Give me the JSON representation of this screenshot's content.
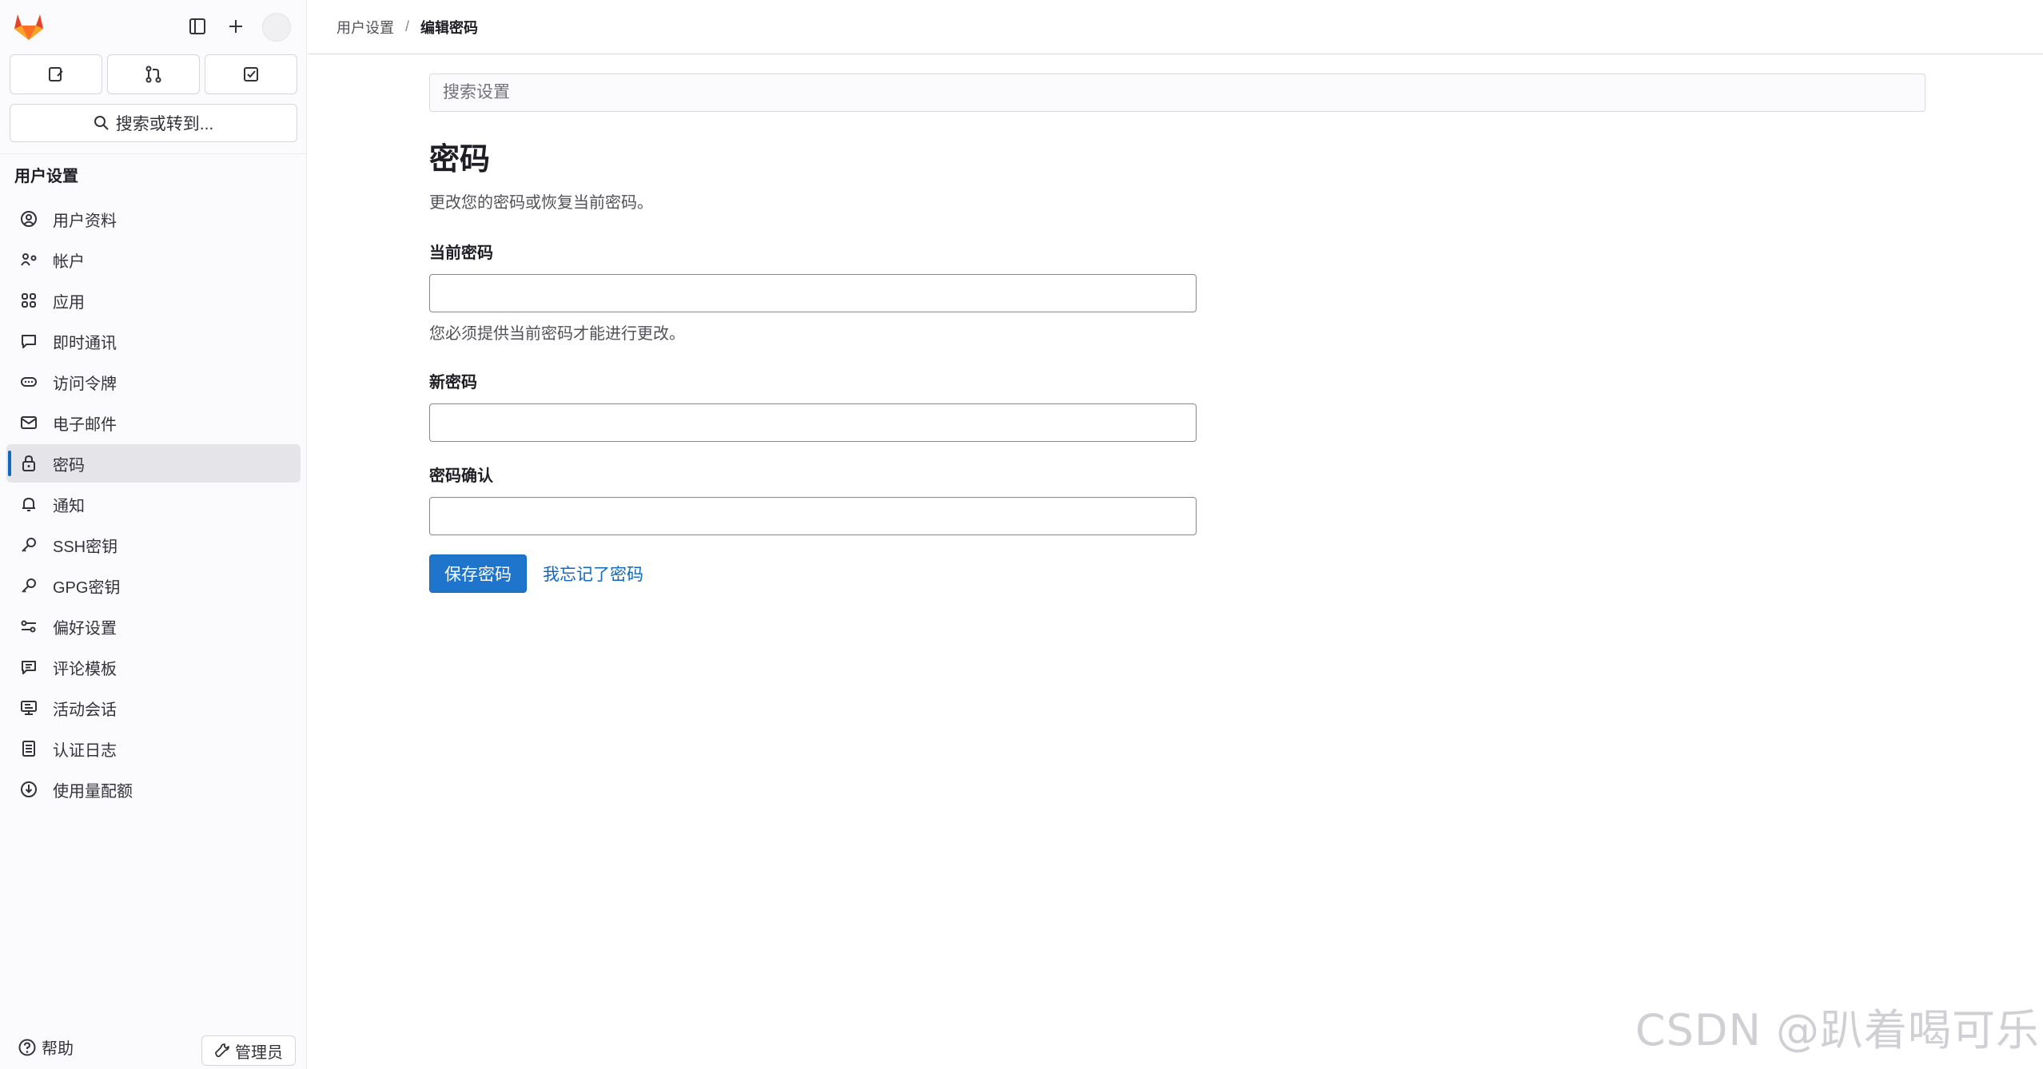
{
  "sidebar": {
    "search_label": "搜索或转到...",
    "heading": "用户设置",
    "items": [
      {
        "label": "用户资料",
        "icon": "profile-icon"
      },
      {
        "label": "帐户",
        "icon": "account-icon"
      },
      {
        "label": "应用",
        "icon": "applications-icon"
      },
      {
        "label": "即时通讯",
        "icon": "chat-icon"
      },
      {
        "label": "访问令牌",
        "icon": "token-icon"
      },
      {
        "label": "电子邮件",
        "icon": "mail-icon"
      },
      {
        "label": "密码",
        "icon": "lock-icon",
        "active": true
      },
      {
        "label": "通知",
        "icon": "bell-icon"
      },
      {
        "label": "SSH密钥",
        "icon": "key-icon"
      },
      {
        "label": "GPG密钥",
        "icon": "key-icon"
      },
      {
        "label": "偏好设置",
        "icon": "preferences-icon"
      },
      {
        "label": "评论模板",
        "icon": "comment-template-icon"
      },
      {
        "label": "活动会话",
        "icon": "monitor-icon"
      },
      {
        "label": "认证日志",
        "icon": "log-icon"
      },
      {
        "label": "使用量配额",
        "icon": "quota-icon"
      }
    ],
    "help_label": "帮助",
    "admin_label": "管理员"
  },
  "breadcrumb": {
    "parent": "用户设置",
    "separator": "/",
    "current": "编辑密码"
  },
  "main": {
    "search_placeholder": "搜索设置",
    "title": "密码",
    "description": "更改您的密码或恢复当前密码。",
    "current_password_label": "当前密码",
    "current_password_hint": "您必须提供当前密码才能进行更改。",
    "new_password_label": "新密码",
    "confirm_password_label": "密码确认",
    "save_label": "保存密码",
    "forgot_label": "我忘记了密码"
  },
  "watermark": "CSDN @趴着喝可乐",
  "colors": {
    "accent": "#1f75cb",
    "link": "#1068bf",
    "sidebar_bg": "#fbfafd",
    "active_bg": "#e4e4e9"
  }
}
